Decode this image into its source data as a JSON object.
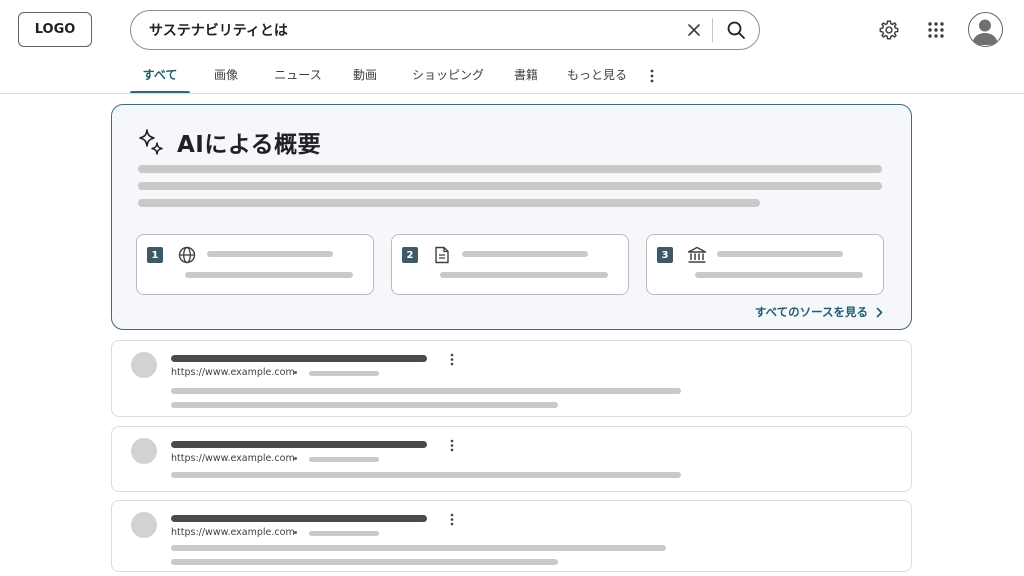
{
  "header": {
    "logo_label": "LOGO",
    "search_value": "サステナビリティとは",
    "icons": [
      "close-icon",
      "search-icon",
      "gear-icon",
      "apps-grid-icon",
      "account-icon"
    ]
  },
  "tabs": [
    {
      "label": "すべて",
      "active": true
    },
    {
      "label": "画像",
      "active": false
    },
    {
      "label": "ニュース",
      "active": false
    },
    {
      "label": "動画",
      "active": false
    },
    {
      "label": "ショッピング",
      "active": false
    },
    {
      "label": "書籍",
      "active": false
    },
    {
      "label": "もっと見る",
      "active": false
    }
  ],
  "ai_overview": {
    "title": "AIによる概要",
    "sources": [
      {
        "number": "1",
        "icon": "globe-icon"
      },
      {
        "number": "2",
        "icon": "document-icon"
      },
      {
        "number": "3",
        "icon": "institution-icon"
      }
    ],
    "see_all_label": "すべてのソースを見る"
  },
  "results": [
    {
      "url": "https://www.example.com"
    },
    {
      "url": "https://www.example.com"
    },
    {
      "url": "https://www.example.com"
    }
  ],
  "colors": {
    "accent": "#2f6b7a",
    "ai_border": "#3d6e7a",
    "ai_background": "#f5f7fa",
    "source_badge": "#3d5a66",
    "placeholder_bar": "#c9c9c9",
    "title_bar": "#4a4a4a"
  }
}
